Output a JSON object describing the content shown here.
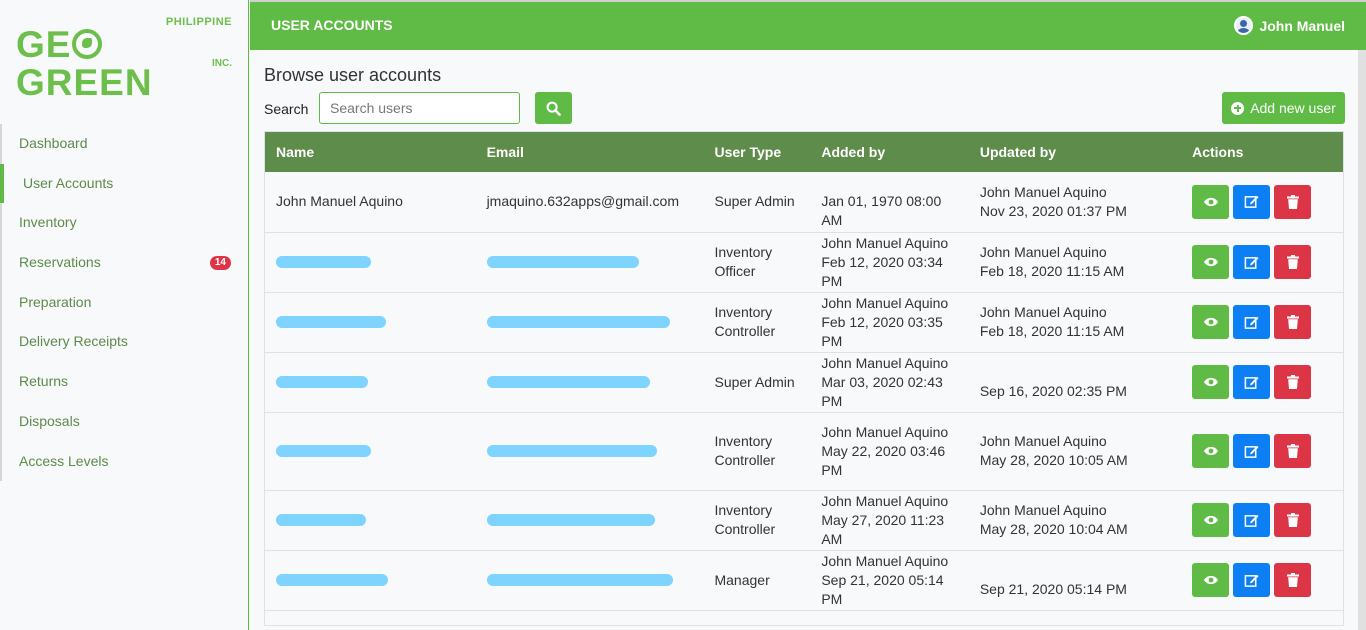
{
  "logo": {
    "top_text": "PHILIPPINE",
    "brand_left": "GE",
    "brand_right": "GREEN",
    "suffix": "INC."
  },
  "sidebar": {
    "items": [
      {
        "label": "Dashboard"
      },
      {
        "label": "User Accounts",
        "active": true
      },
      {
        "label": "Inventory"
      },
      {
        "label": "Reservations",
        "badge": "14"
      },
      {
        "label": "Preparation"
      },
      {
        "label": "Delivery Receipts"
      },
      {
        "label": "Returns"
      },
      {
        "label": "Disposals"
      },
      {
        "label": "Access Levels"
      }
    ]
  },
  "header": {
    "title": "USER ACCOUNTS",
    "user_name": "John Manuel"
  },
  "main": {
    "page_title": "Browse user accounts",
    "search_label": "Search",
    "search_placeholder": "Search users",
    "add_button": "Add new user"
  },
  "table": {
    "columns": [
      "Name",
      "Email",
      "User Type",
      "Added by",
      "Updated by",
      "Actions"
    ],
    "rows": [
      {
        "name": "John Manuel Aquino",
        "email": "jmaquino.632apps@gmail.com",
        "user_type": "Super Admin",
        "added_by_name": "",
        "added_by_date": "Jan 01, 1970 08:00 AM",
        "updated_by_name": "John Manuel Aquino",
        "updated_by_date": "Nov 23, 2020 01:37 PM",
        "redacted": false
      },
      {
        "name": "",
        "email": "",
        "user_type": "Inventory Officer",
        "added_by_name": "John Manuel Aquino",
        "added_by_date": "Feb 12, 2020 03:34 PM",
        "updated_by_name": "John Manuel Aquino",
        "updated_by_date": "Feb 18, 2020 11:15 AM",
        "redacted": true
      },
      {
        "name": "",
        "email": "",
        "user_type": "Inventory Controller",
        "added_by_name": "John Manuel Aquino",
        "added_by_date": "Feb 12, 2020 03:35 PM",
        "updated_by_name": "John Manuel Aquino",
        "updated_by_date": "Feb 18, 2020 11:15 AM",
        "redacted": true
      },
      {
        "name": "",
        "email": "",
        "user_type": "Super Admin",
        "added_by_name": "John Manuel Aquino",
        "added_by_date": "Mar 03, 2020 02:43 PM",
        "updated_by_name": "",
        "updated_by_date": "Sep 16, 2020 02:35 PM",
        "redacted": true
      },
      {
        "name": "",
        "email": "",
        "user_type": "Inventory Controller",
        "added_by_name": "John Manuel Aquino",
        "added_by_date": "May 22, 2020 03:46 PM",
        "updated_by_name": "John Manuel Aquino",
        "updated_by_date": "May 28, 2020 10:05 AM",
        "redacted": true
      },
      {
        "name": "",
        "email": "",
        "user_type": "Inventory Controller",
        "added_by_name": "John Manuel Aquino",
        "added_by_date": "May 27, 2020 11:23 AM",
        "updated_by_name": "John Manuel Aquino",
        "updated_by_date": "May 28, 2020 10:04 AM",
        "redacted": true
      },
      {
        "name": "",
        "email": "",
        "user_type": "Manager",
        "added_by_name": "John Manuel Aquino",
        "added_by_date": "Sep 21, 2020 05:14 PM",
        "updated_by_name": "",
        "updated_by_date": "Sep 21, 2020 05:14 PM",
        "redacted": true
      }
    ]
  },
  "colors": {
    "brand_green": "#5fbb46",
    "header_row": "#5e8c4a",
    "view_btn": "#5fbb46",
    "edit_btn": "#0d7ff5",
    "delete_btn": "#dc3545",
    "badge": "#dc3545"
  },
  "icons": {
    "search": "search-icon",
    "add": "plus-circle-icon",
    "view": "eye-icon",
    "edit": "edit-icon",
    "delete": "trash-icon",
    "user": "user-avatar-icon"
  }
}
